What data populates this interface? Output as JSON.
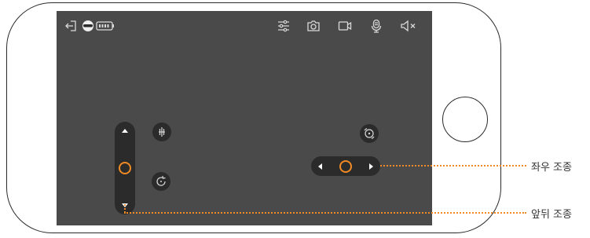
{
  "annotations": {
    "lateral_control_label": "좌우 조종",
    "forward_backward_control_label": "앞뒤 조종"
  },
  "toolbar": {
    "left": [
      "exit-icon",
      "robot-icon",
      "battery-icon"
    ],
    "right": [
      "settings-sliders-icon",
      "camera-icon",
      "video-record-icon",
      "microphone-icon",
      "speaker-mute-icon"
    ]
  },
  "controls": {
    "vertical_knob_level": 0.5,
    "horizontal_knob_level": 0.5
  },
  "colors": {
    "screen": "#4a4a4a",
    "pad": "#2b2b2b",
    "accent": "#f08a24",
    "icon": "#d9d9d9"
  }
}
